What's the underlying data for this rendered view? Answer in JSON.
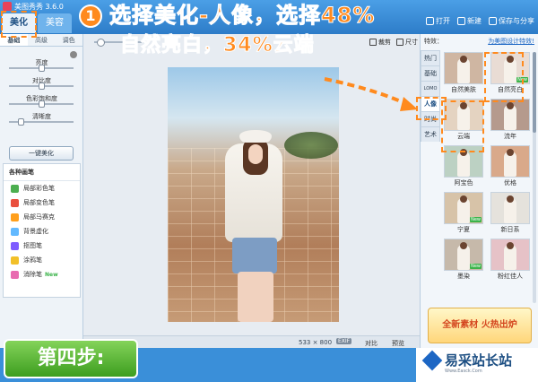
{
  "app": {
    "title": "美图秀秀 3.6.0"
  },
  "main_tabs": [
    {
      "label": "美化",
      "active": true
    },
    {
      "label": "美容",
      "active": false
    }
  ],
  "top_actions": [
    {
      "label": "打开",
      "icon": "open-icon"
    },
    {
      "label": "新建",
      "icon": "new-icon"
    },
    {
      "label": "保存与分享",
      "icon": "save-icon"
    }
  ],
  "left_panel": {
    "sub_tabs": [
      "基础",
      "高级",
      "调色"
    ],
    "sliders": [
      {
        "label": "亮度",
        "value": 0.5
      },
      {
        "label": "对比度",
        "value": 0.5
      },
      {
        "label": "色彩饱和度",
        "value": 0.5
      },
      {
        "label": "清晰度",
        "value": 0.15
      }
    ],
    "one_click_label": "一键美化",
    "brush_title": "各种画笔",
    "brushes": [
      {
        "label": "局部彩色笔",
        "color": "#4caf50"
      },
      {
        "label": "局部变色笔",
        "color": "#e94f3d"
      },
      {
        "label": "局部马赛克",
        "color": "#ff9f1c"
      },
      {
        "label": "背景虚化",
        "color": "#62b9ff"
      },
      {
        "label": "抠图笔",
        "color": "#7e5cff"
      },
      {
        "label": "涂鸦笔",
        "color": "#f2c029"
      },
      {
        "label": "消除笔",
        "color": "#e86bb0",
        "new": "New"
      }
    ]
  },
  "canvas": {
    "tools": [
      {
        "label": "裁剪",
        "icon": "crop-icon"
      },
      {
        "label": "尺寸",
        "icon": "resize-icon"
      }
    ],
    "size_readout": "533 × 800",
    "exif_label": "EXIF",
    "compare_label": "对比",
    "preview_label": "预览"
  },
  "effects": {
    "header": "特效：",
    "link": "为美图设计特效!",
    "categories": [
      {
        "label": "热门",
        "active": false
      },
      {
        "label": "基础",
        "active": false
      },
      {
        "label": "LOMO",
        "active": false
      },
      {
        "label": "人像",
        "active": true
      },
      {
        "label": "时尚",
        "active": false
      },
      {
        "label": "艺术",
        "active": false
      }
    ],
    "items": [
      {
        "label": "自然美肤",
        "bg": "#cfb6a2",
        "new": ""
      },
      {
        "label": "自然亮白",
        "bg": "#e9dcd4",
        "new": "New"
      },
      {
        "label": "云端",
        "bg": "#e4d3c1",
        "new": ""
      },
      {
        "label": "流年",
        "bg": "#b59a8d",
        "new": ""
      },
      {
        "label": "阿宝色",
        "bg": "#bcd1c3",
        "new": ""
      },
      {
        "label": "优格",
        "bg": "#d9a98a",
        "new": ""
      },
      {
        "label": "宁夏",
        "bg": "#d7c3a8",
        "new": "New"
      },
      {
        "label": "新日系",
        "bg": "#e5e2dc",
        "new": ""
      },
      {
        "label": "墨染",
        "bg": "#c6b9aa",
        "new": "New"
      },
      {
        "label": "粉红佳人",
        "bg": "#e6c2c7",
        "new": ""
      }
    ],
    "ad_text": "全新素材 火热出炉"
  },
  "annotation": {
    "step_number": "1",
    "line1": "选择美化-人像，选择48%",
    "line2": "自然亮白，34%云端",
    "color": "#ff8a1e"
  },
  "step_badge": "第四步:",
  "watermark": {
    "text": "易采站长站",
    "sub": "Www.Easck.Com"
  }
}
